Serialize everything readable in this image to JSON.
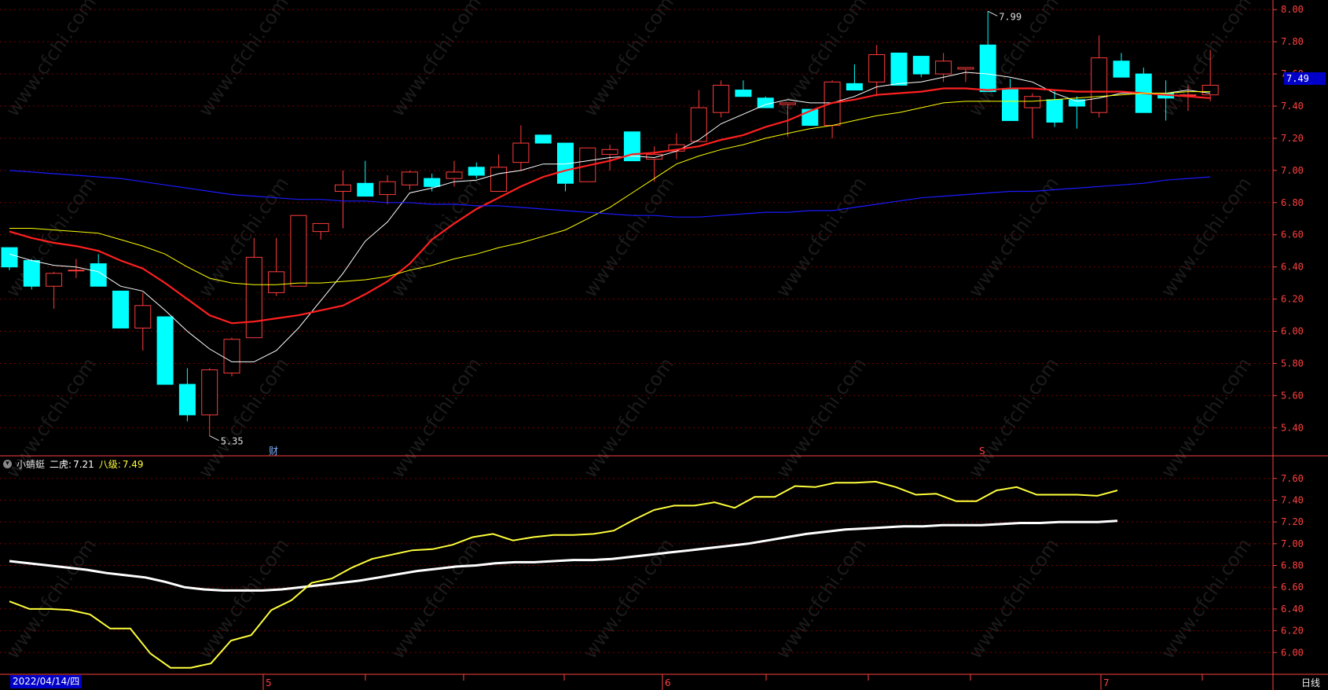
{
  "indicator": {
    "name": "小蜻蜓",
    "line1_label": "二虎:",
    "line1_value": "7.21",
    "line2_label": "八级:",
    "line2_value": "7.49"
  },
  "footer": {
    "date": "2022/04/14/四",
    "period": "日线",
    "month_marks": [
      "5",
      "6",
      "7"
    ]
  },
  "price_badge": "7.49",
  "markers": {
    "fin": "财",
    "s": "S"
  },
  "annotations": {
    "high": "7.99",
    "low": "5.35"
  },
  "colors": {
    "up": "#ff3c3c",
    "down": "#00ffff",
    "ma5": "#ffffff",
    "ma10": "#ff2020",
    "ma20": "#ffff00",
    "ma60": "#1a1aff",
    "grid": "#7a0000",
    "axis": "#ff4040",
    "ind_white": "#ffffff",
    "ind_yellow": "#ffff3c"
  },
  "watermark": "www.cfchi.com",
  "chart_data": [
    {
      "type": "candlestick",
      "title": "",
      "yticks": [
        5.4,
        5.6,
        5.8,
        6.0,
        6.2,
        6.4,
        6.6,
        6.8,
        7.0,
        7.2,
        7.4,
        7.6,
        7.8,
        8.0
      ],
      "ylim": [
        5.25,
        8.05
      ],
      "grid": true,
      "ohlc": [
        [
          6.52,
          6.52,
          6.38,
          6.4
        ],
        [
          6.44,
          6.45,
          6.26,
          6.28
        ],
        [
          6.28,
          6.37,
          6.14,
          6.36
        ],
        [
          6.38,
          6.45,
          6.33,
          6.38
        ],
        [
          6.42,
          6.48,
          6.28,
          6.28
        ],
        [
          6.25,
          6.25,
          6.02,
          6.02
        ],
        [
          6.02,
          6.24,
          5.88,
          6.16
        ],
        [
          6.09,
          6.09,
          5.67,
          5.67
        ],
        [
          5.67,
          5.77,
          5.44,
          5.48
        ],
        [
          5.48,
          5.77,
          5.35,
          5.76
        ],
        [
          5.74,
          5.96,
          5.72,
          5.95
        ],
        [
          5.96,
          6.58,
          5.96,
          6.46
        ],
        [
          6.24,
          6.58,
          6.22,
          6.37
        ],
        [
          6.28,
          6.72,
          6.28,
          6.72
        ],
        [
          6.62,
          6.67,
          6.57,
          6.67
        ],
        [
          6.87,
          7.0,
          6.64,
          6.91
        ],
        [
          6.92,
          7.06,
          6.84,
          6.84
        ],
        [
          6.85,
          6.97,
          6.79,
          6.93
        ],
        [
          6.91,
          7.0,
          6.88,
          6.99
        ],
        [
          6.95,
          6.98,
          6.87,
          6.9
        ],
        [
          6.95,
          7.06,
          6.9,
          6.99
        ],
        [
          7.02,
          7.05,
          6.95,
          6.97
        ],
        [
          6.87,
          7.1,
          6.87,
          7.02
        ],
        [
          7.05,
          7.28,
          7.0,
          7.17
        ],
        [
          7.22,
          7.22,
          7.17,
          7.17
        ],
        [
          7.17,
          7.17,
          6.87,
          6.92
        ],
        [
          6.93,
          7.14,
          6.93,
          7.14
        ],
        [
          7.1,
          7.16,
          7.0,
          7.13
        ],
        [
          7.24,
          7.24,
          7.06,
          7.06
        ],
        [
          7.07,
          7.15,
          6.93,
          7.1
        ],
        [
          7.12,
          7.23,
          7.07,
          7.16
        ],
        [
          7.18,
          7.5,
          7.18,
          7.39
        ],
        [
          7.36,
          7.56,
          7.33,
          7.53
        ],
        [
          7.5,
          7.56,
          7.46,
          7.46
        ],
        [
          7.45,
          7.46,
          7.39,
          7.39
        ],
        [
          7.41,
          7.42,
          7.21,
          7.42
        ],
        [
          7.38,
          7.38,
          7.28,
          7.28
        ],
        [
          7.28,
          7.56,
          7.2,
          7.55
        ],
        [
          7.54,
          7.66,
          7.5,
          7.5
        ],
        [
          7.55,
          7.78,
          7.46,
          7.72
        ],
        [
          7.73,
          7.73,
          7.53,
          7.53
        ],
        [
          7.71,
          7.71,
          7.58,
          7.6
        ],
        [
          7.6,
          7.73,
          7.55,
          7.68
        ],
        [
          7.63,
          7.64,
          7.55,
          7.64
        ],
        [
          7.78,
          7.99,
          7.49,
          7.49
        ],
        [
          7.51,
          7.57,
          7.31,
          7.31
        ],
        [
          7.39,
          7.48,
          7.2,
          7.46
        ],
        [
          7.44,
          7.5,
          7.27,
          7.3
        ],
        [
          7.44,
          7.46,
          7.26,
          7.4
        ],
        [
          7.36,
          7.84,
          7.33,
          7.7
        ],
        [
          7.68,
          7.73,
          7.58,
          7.58
        ],
        [
          7.6,
          7.64,
          7.36,
          7.36
        ],
        [
          7.48,
          7.56,
          7.31,
          7.45
        ],
        [
          7.47,
          7.53,
          7.37,
          7.47
        ],
        [
          7.47,
          7.75,
          7.43,
          7.53
        ]
      ],
      "series": [
        {
          "type": "line",
          "values": [
            6.48,
            6.44,
            6.41,
            6.4,
            6.37,
            6.28,
            6.25,
            6.13,
            6.0,
            5.89,
            5.81,
            5.81,
            5.88,
            6.02,
            6.19,
            6.36,
            6.56,
            6.68,
            6.86,
            6.89,
            6.93,
            6.94,
            6.98,
            7.0,
            7.04,
            7.04,
            7.06,
            7.08,
            7.09,
            7.08,
            7.12,
            7.19,
            7.29,
            7.35,
            7.41,
            7.44,
            7.42,
            7.42,
            7.46,
            7.52,
            7.54,
            7.55,
            7.58,
            7.61,
            7.6,
            7.58,
            7.55,
            7.48,
            7.43,
            7.45,
            7.48,
            7.48,
            7.48,
            7.5,
            7.48
          ]
        },
        {
          "type": "line",
          "values": [
            6.62,
            6.58,
            6.55,
            6.53,
            6.5,
            6.44,
            6.39,
            6.3,
            6.2,
            6.1,
            6.05,
            6.06,
            6.08,
            6.1,
            6.13,
            6.16,
            6.23,
            6.31,
            6.42,
            6.57,
            6.67,
            6.76,
            6.83,
            6.9,
            6.96,
            7.0,
            7.03,
            7.06,
            7.1,
            7.11,
            7.13,
            7.15,
            7.19,
            7.22,
            7.27,
            7.31,
            7.37,
            7.42,
            7.44,
            7.47,
            7.48,
            7.49,
            7.51,
            7.51,
            7.5,
            7.51,
            7.51,
            7.5,
            7.49,
            7.49,
            7.49,
            7.48,
            7.47,
            7.46,
            7.45
          ]
        },
        {
          "type": "line",
          "values": [
            6.64,
            6.64,
            6.63,
            6.62,
            6.61,
            6.57,
            6.53,
            6.48,
            6.4,
            6.33,
            6.3,
            6.29,
            6.29,
            6.3,
            6.3,
            6.31,
            6.32,
            6.34,
            6.38,
            6.41,
            6.45,
            6.48,
            6.52,
            6.55,
            6.59,
            6.63,
            6.7,
            6.77,
            6.86,
            6.95,
            7.04,
            7.09,
            7.13,
            7.16,
            7.2,
            7.23,
            7.26,
            7.28,
            7.31,
            7.34,
            7.36,
            7.39,
            7.42,
            7.43,
            7.43,
            7.43,
            7.43,
            7.44,
            7.45,
            7.46,
            7.47,
            7.48,
            7.48,
            7.49,
            7.49
          ]
        },
        {
          "type": "line",
          "values": [
            7.0,
            6.99,
            6.98,
            6.97,
            6.96,
            6.95,
            6.93,
            6.91,
            6.89,
            6.87,
            6.85,
            6.84,
            6.83,
            6.82,
            6.82,
            6.81,
            6.81,
            6.8,
            6.8,
            6.79,
            6.79,
            6.78,
            6.78,
            6.77,
            6.76,
            6.75,
            6.74,
            6.73,
            6.72,
            6.72,
            6.71,
            6.71,
            6.72,
            6.73,
            6.74,
            6.74,
            6.75,
            6.75,
            6.77,
            6.79,
            6.81,
            6.83,
            6.84,
            6.85,
            6.86,
            6.87,
            6.87,
            6.88,
            6.89,
            6.9,
            6.91,
            6.92,
            6.94,
            6.95,
            6.96
          ]
        }
      ]
    },
    {
      "type": "line",
      "title": "",
      "yticks": [
        6.0,
        6.2,
        6.4,
        6.6,
        6.8,
        7.0,
        7.2,
        7.4,
        7.6
      ],
      "ylim": [
        5.8,
        7.75
      ],
      "grid": true,
      "series": [
        {
          "name": "二虎",
          "values": [
            6.84,
            6.82,
            6.8,
            6.78,
            6.76,
            6.73,
            6.71,
            6.69,
            6.65,
            6.6,
            6.58,
            6.57,
            6.57,
            6.57,
            6.58,
            6.6,
            6.62,
            6.64,
            6.66,
            6.69,
            6.72,
            6.75,
            6.77,
            6.79,
            6.8,
            6.82,
            6.83,
            6.83,
            6.84,
            6.85,
            6.85,
            6.86,
            6.88,
            6.9,
            6.92,
            6.94,
            6.96,
            6.98,
            7.0,
            7.03,
            7.06,
            7.09,
            7.11,
            7.13,
            7.14,
            7.15,
            7.16,
            7.16,
            7.17,
            7.17,
            7.17,
            7.18,
            7.19,
            7.19,
            7.2,
            7.2,
            7.2,
            7.21
          ]
        },
        {
          "name": "八级",
          "values": [
            6.47,
            6.4,
            6.4,
            6.39,
            6.35,
            6.22,
            6.22,
            5.99,
            5.86,
            5.86,
            5.9,
            6.11,
            6.16,
            6.39,
            6.48,
            6.64,
            6.68,
            6.78,
            6.86,
            6.9,
            6.94,
            6.95,
            6.99,
            7.06,
            7.09,
            7.03,
            7.06,
            7.08,
            7.08,
            7.09,
            7.12,
            7.22,
            7.31,
            7.35,
            7.35,
            7.38,
            7.33,
            7.43,
            7.43,
            7.53,
            7.52,
            7.56,
            7.56,
            7.57,
            7.52,
            7.45,
            7.46,
            7.39,
            7.39,
            7.49,
            7.52,
            7.45,
            7.45,
            7.45,
            7.44,
            7.49
          ]
        }
      ]
    }
  ]
}
